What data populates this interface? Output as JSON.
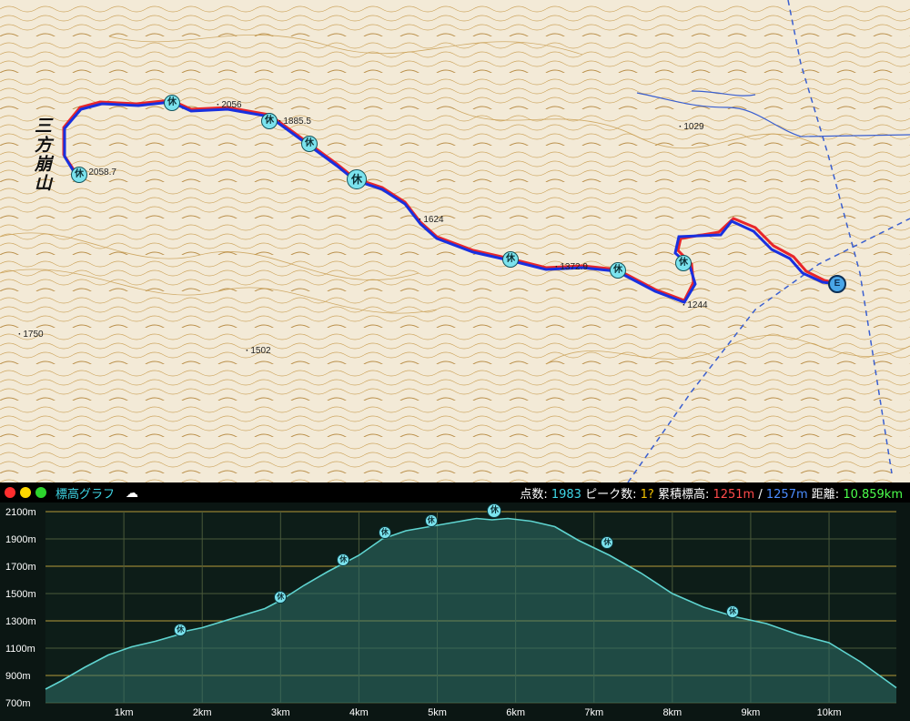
{
  "map": {
    "mountain_name": "三方崩山",
    "elevation_labels": [
      {
        "text": "2058.7"
      },
      {
        "text": "2056"
      },
      {
        "text": "1885.5"
      },
      {
        "text": "1624"
      },
      {
        "text": "1372.9"
      },
      {
        "text": "1029"
      },
      {
        "text": "1244"
      },
      {
        "text": "1750"
      },
      {
        "text": "1502"
      }
    ],
    "rest_label": "休",
    "end_label": "E",
    "route_colors": {
      "planned": "#e8262a",
      "track": "#1830e0"
    },
    "river_color": "#3a5fd0",
    "contour_color": "#c79a4a"
  },
  "graph": {
    "title": "標高グラフ",
    "window_dots": [
      {
        "name": "close",
        "color": "#ff2d2d"
      },
      {
        "name": "minimize",
        "color": "#ffd800"
      },
      {
        "name": "maximize",
        "color": "#2dd42d"
      }
    ],
    "cloud_icon": "☁",
    "stats": {
      "points_label": "点数:",
      "points_value": "1983",
      "peaks_label": "ピーク数:",
      "peaks_value": "1?",
      "gain_label": "累積標高:",
      "gain_up": "1251m",
      "separator": "/",
      "gain_down": "1257m",
      "distance_label": "距離:",
      "distance_value": "10.859km"
    }
  },
  "chart_data": {
    "type": "area",
    "xlabel": "",
    "ylabel": "",
    "xlim": [
      0,
      10.859
    ],
    "ylim": [
      700,
      2100
    ],
    "y_ticks": [
      "2100m",
      "1900m",
      "1700m",
      "1500m",
      "1300m",
      "1100m",
      "900m",
      "700m"
    ],
    "x_ticks": [
      "1km",
      "2km",
      "3km",
      "4km",
      "5km",
      "6km",
      "7km",
      "8km",
      "9km",
      "10km"
    ],
    "series": [
      {
        "x": [
          0.0,
          0.2,
          0.5,
          0.8,
          1.1,
          1.4,
          1.7,
          1.75,
          2.0,
          2.4,
          2.8,
          3.0,
          3.3,
          3.6,
          3.8,
          4.0,
          4.3,
          4.6,
          5.0,
          5.3,
          5.5,
          5.7,
          5.9,
          6.2,
          6.5,
          6.8,
          7.2,
          7.6,
          8.0,
          8.4,
          8.8,
          9.2,
          9.6,
          10.0,
          10.4,
          10.859
        ],
        "y": [
          800,
          860,
          960,
          1050,
          1110,
          1150,
          1200,
          1220,
          1250,
          1320,
          1390,
          1450,
          1560,
          1660,
          1720,
          1780,
          1900,
          1960,
          2000,
          2030,
          2050,
          2040,
          2050,
          2030,
          1990,
          1890,
          1780,
          1650,
          1500,
          1400,
          1330,
          1280,
          1200,
          1140,
          1000,
          810
        ]
      }
    ],
    "rest_points": [
      {
        "x": 1.72,
        "y": 1235
      },
      {
        "x": 3.0,
        "y": 1475
      },
      {
        "x": 3.8,
        "y": 1745
      },
      {
        "x": 4.33,
        "y": 1950
      },
      {
        "x": 4.92,
        "y": 2035
      },
      {
        "x": 5.73,
        "y": 2105
      },
      {
        "x": 7.17,
        "y": 1875
      },
      {
        "x": 8.77,
        "y": 1370
      }
    ],
    "grid": true,
    "colors": {
      "line": "#5fd4d0",
      "fill": "#2f6f6a",
      "grid_major": "#b59a3a",
      "grid_minor": "#4b5a3a",
      "axis_text": "#ffffff"
    }
  }
}
